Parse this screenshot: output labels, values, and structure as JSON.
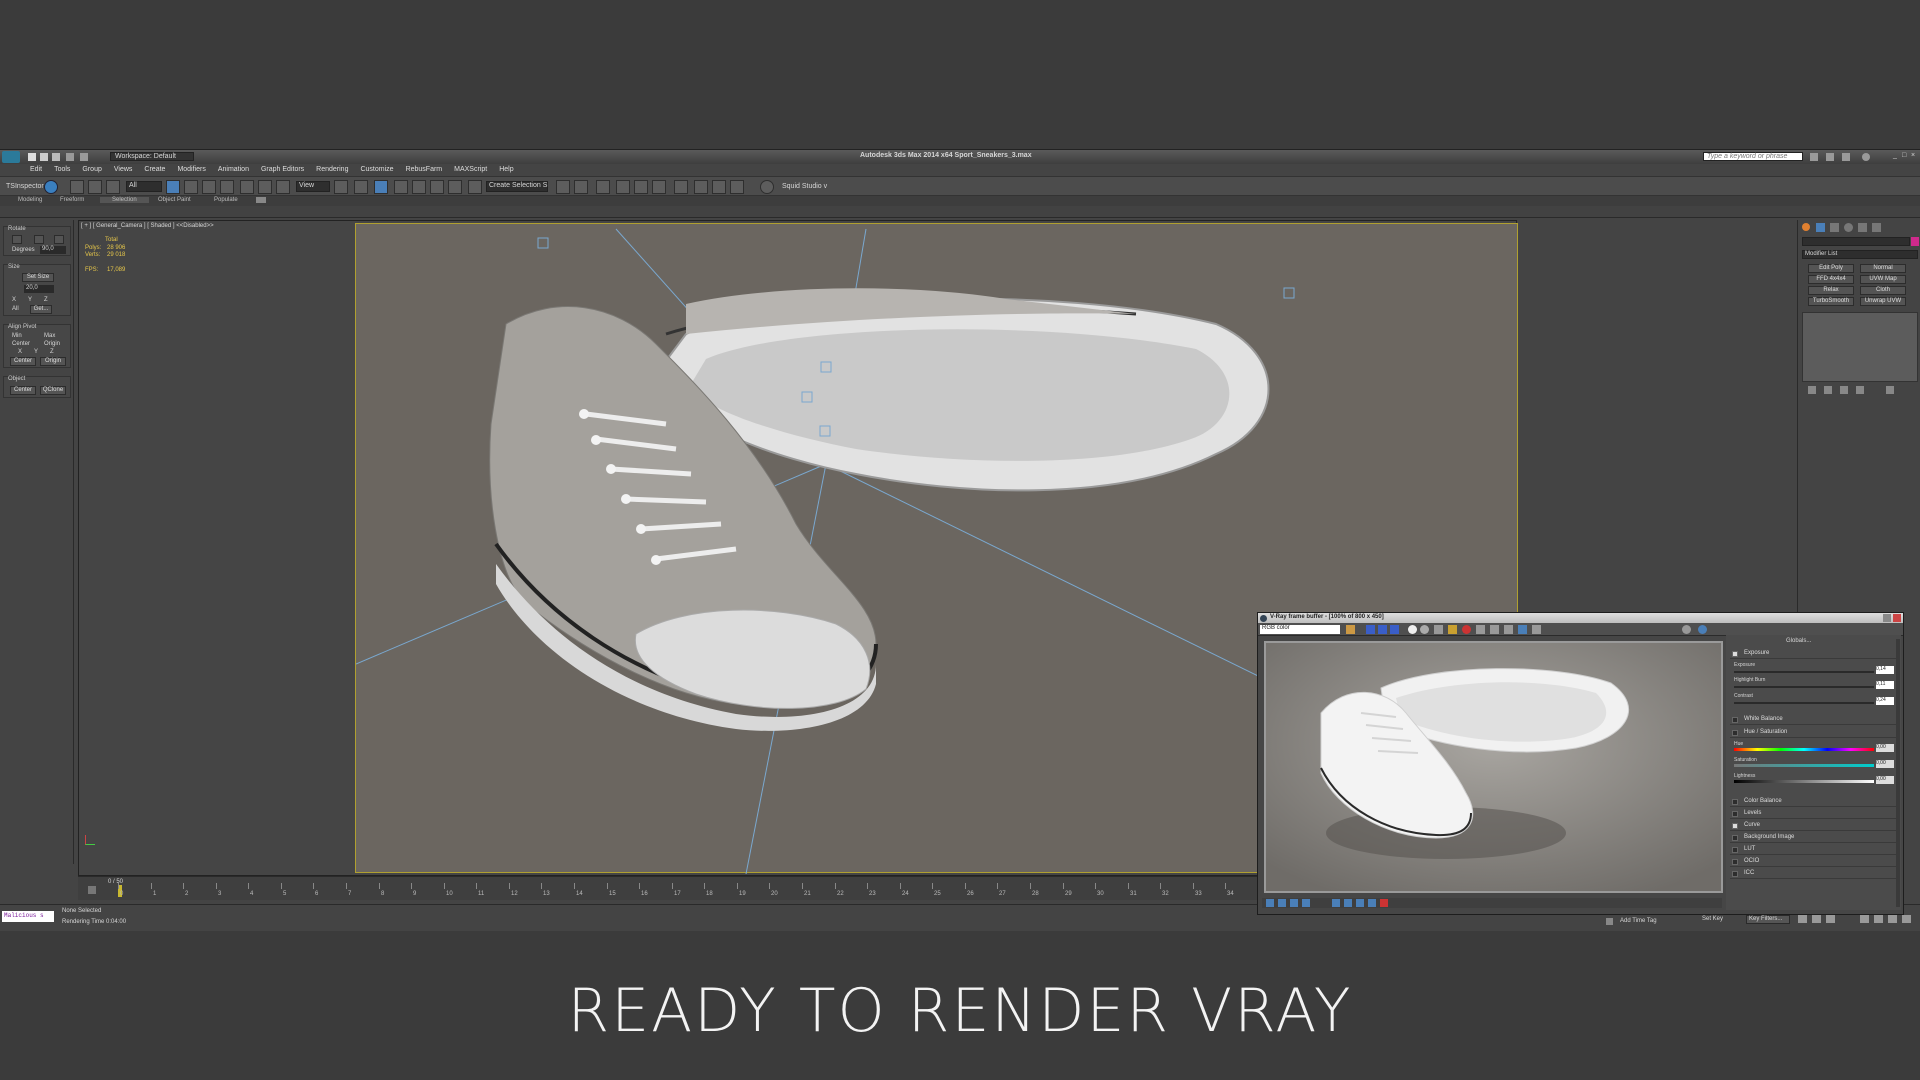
{
  "window": {
    "title": "Autodesk 3ds Max  2014 x64    Sport_Sneakers_3.max",
    "workspace": "Workspace: Default",
    "search_placeholder": "Type a keyword or phrase"
  },
  "menu": [
    "Edit",
    "Tools",
    "Group",
    "Views",
    "Create",
    "Modifiers",
    "Animation",
    "Graph Editors",
    "Rendering",
    "Customize",
    "RebusFarm",
    "MAXScript",
    "Help"
  ],
  "toolbar": {
    "selection_filter": "All",
    "view": "View",
    "named_selection": "Create Selection S",
    "tsinspector": "TSInspector",
    "squid": "Squid Studio v"
  },
  "ribbon": [
    "Modeling",
    "Freeform",
    "Selection",
    "Object Paint",
    "Populate"
  ],
  "left_panel": {
    "rotate_label": "Rotate",
    "degrees_label": "Degrees",
    "degrees_value": "90,0",
    "size_label": "Size",
    "set_size": "Set Size",
    "size_value": "20,0",
    "axis_x": "X",
    "axis_y": "Y",
    "axis_z": "Z",
    "all": "All",
    "get": "Get...",
    "align_pivot": "Align Pivot",
    "min": "Min",
    "max": "Max",
    "center": "Center",
    "origin": "Origin",
    "object": "Object",
    "qclone": "QClone"
  },
  "viewport": {
    "label": "[ + ] [ General_Camera ] [ Shaded ]  <<Disabled>>",
    "stats_total": "Total",
    "polys_label": "Polys:",
    "polys_value": "28 906",
    "verts_label": "Verts:",
    "verts_value": "29 018",
    "fps_label": "FPS:",
    "fps_value": "17,089"
  },
  "right_panel": {
    "modifier_list": "Modifier List",
    "buttons": [
      "Edit Poly",
      "Normal",
      "FFD 4x4x4",
      "UVW Map",
      "Relax",
      "Cloth",
      "TurboSmooth",
      "Unwrap UVW"
    ]
  },
  "timeline": {
    "frame": "0 / 50",
    "ticks": [
      "0",
      "1",
      "2",
      "3",
      "4",
      "5",
      "6",
      "7",
      "8",
      "9",
      "10",
      "11",
      "12",
      "13",
      "14",
      "15",
      "16",
      "17",
      "18",
      "19",
      "20",
      "21",
      "22",
      "23",
      "24",
      "25",
      "26",
      "27",
      "28",
      "29",
      "30",
      "31",
      "32",
      "33",
      "34"
    ]
  },
  "status": {
    "script_field": "Malicious s",
    "selection": "None Selected",
    "render_time": "Rendering Time  0:04:00",
    "add_time_tag": "Add Time Tag",
    "set_key": "Set Key",
    "key_filters": "Key Filters..."
  },
  "vfb": {
    "title": "V-Ray frame buffer - [100% of 800 x 450]",
    "channel": "RGB color",
    "globals": "Globals...",
    "exposure": "Exposure",
    "exposure_val": "0,14",
    "highlight_burn": "Highlight Burn",
    "highlight_val": "0,11",
    "contrast": "Contrast",
    "contrast_val": "0,24",
    "white_balance": "White Balance",
    "hue_saturation": "Hue / Saturation",
    "hue": "Hue",
    "saturation": "Saturation",
    "lightness": "Lightness",
    "hue_val": "0,00",
    "sat_val": "0,00",
    "light_val": "0,00",
    "color_balance": "Color Balance",
    "levels": "Levels",
    "curve": "Curve",
    "background_image": "Background Image",
    "lut": "LUT",
    "ocio": "OCIO",
    "icc": "ICC"
  },
  "caption": "READY TO RENDER  VRAY",
  "colors": {
    "accent": "#f0c020",
    "frame_border": "#b0a030",
    "camera_bg": "#6b6660"
  }
}
